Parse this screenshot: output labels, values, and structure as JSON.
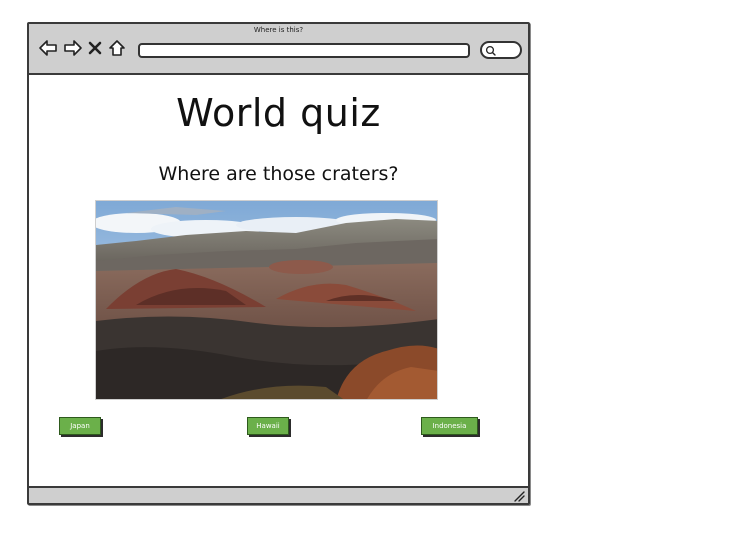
{
  "window": {
    "title": "Where is this?"
  },
  "page": {
    "heading": "World quiz",
    "question": "Where are those craters?"
  },
  "photo": {
    "alt": "volcanic crater landscape"
  },
  "answers": [
    {
      "label": "Japan"
    },
    {
      "label": "Hawaii"
    },
    {
      "label": "Indonesia"
    }
  ],
  "colors": {
    "button": "#6bb04a",
    "chrome": "#cfcfcf",
    "outline": "#3a3a3a"
  },
  "icons": [
    "back-arrow-icon",
    "forward-arrow-icon",
    "close-icon",
    "home-icon",
    "search-icon",
    "resize-grip-icon"
  ]
}
